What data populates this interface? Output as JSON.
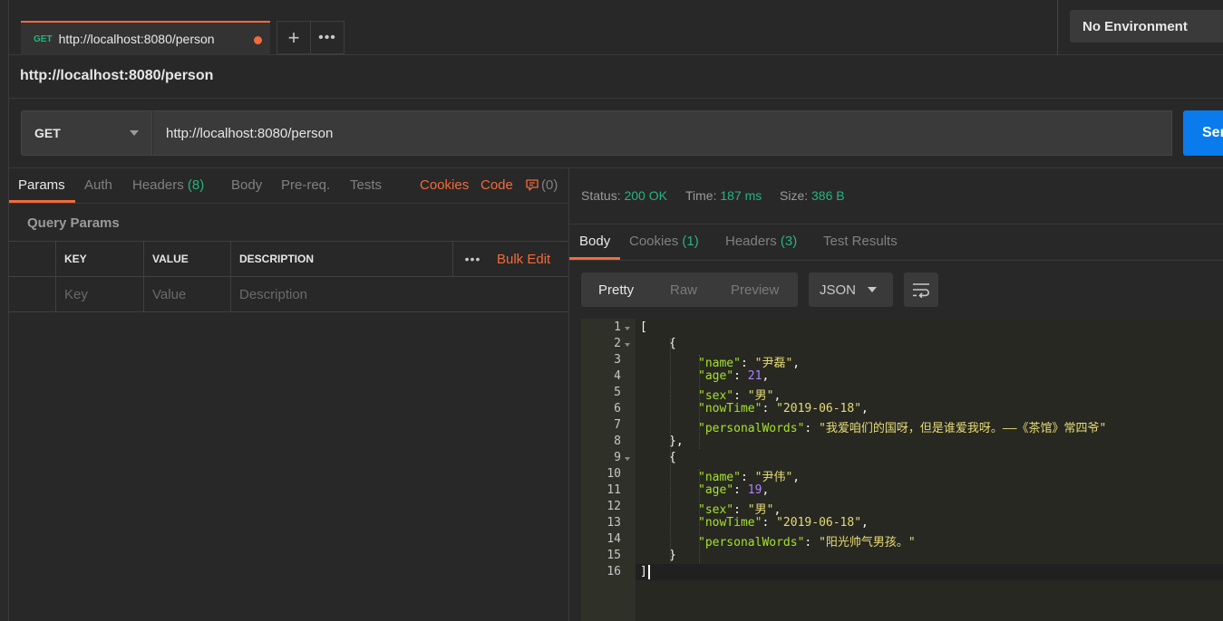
{
  "tab": {
    "method": "GET",
    "url": "http://localhost:8080/person"
  },
  "environment": {
    "selected": "No Environment"
  },
  "request": {
    "title": "http://localhost:8080/person",
    "method": "GET",
    "url": "http://localhost:8080/person",
    "send_label": "Send"
  },
  "request_tabs": {
    "params": "Params",
    "auth": "Auth",
    "headers": "Headers",
    "headers_count": "(8)",
    "body": "Body",
    "prereq": "Pre-req.",
    "tests": "Tests",
    "cookies": "Cookies",
    "code": "Code",
    "comments_count": "(0)"
  },
  "query_params": {
    "title": "Query Params",
    "headers": [
      "KEY",
      "VALUE",
      "DESCRIPTION"
    ],
    "bulk_edit": "Bulk Edit",
    "placeholders": [
      "Key",
      "Value",
      "Description"
    ]
  },
  "response": {
    "status_label": "Status:",
    "status_value": "200 OK",
    "time_label": "Time:",
    "time_value": "187 ms",
    "size_label": "Size:",
    "size_value": "386 B",
    "tabs": {
      "body": "Body",
      "cookies": "Cookies",
      "cookies_count": "(1)",
      "headers": "Headers",
      "headers_count": "(3)",
      "test_results": "Test Results"
    },
    "view_modes": [
      "Pretty",
      "Raw",
      "Preview"
    ],
    "format": "JSON"
  },
  "body_lines": [
    {
      "n": "1",
      "indent": 0,
      "parts": [
        [
          "p",
          "["
        ]
      ],
      "fold": true
    },
    {
      "n": "2",
      "indent": 1,
      "parts": [
        [
          "p",
          "{"
        ]
      ],
      "fold": true
    },
    {
      "n": "3",
      "indent": 2,
      "parts": [
        [
          "k",
          "\"name\""
        ],
        [
          "p",
          ": "
        ],
        [
          "s",
          "\"尹磊\""
        ],
        [
          "p",
          ","
        ]
      ]
    },
    {
      "n": "4",
      "indent": 2,
      "parts": [
        [
          "k",
          "\"age\""
        ],
        [
          "p",
          ": "
        ],
        [
          "n",
          "21"
        ],
        [
          "p",
          ","
        ]
      ]
    },
    {
      "n": "5",
      "indent": 2,
      "parts": [
        [
          "k",
          "\"sex\""
        ],
        [
          "p",
          ": "
        ],
        [
          "s",
          "\"男\""
        ],
        [
          "p",
          ","
        ]
      ]
    },
    {
      "n": "6",
      "indent": 2,
      "parts": [
        [
          "k",
          "\"nowTime\""
        ],
        [
          "p",
          ": "
        ],
        [
          "s",
          "\"2019-06-18\""
        ],
        [
          "p",
          ","
        ]
      ]
    },
    {
      "n": "7",
      "indent": 2,
      "parts": [
        [
          "k",
          "\"personalWords\""
        ],
        [
          "p",
          ": "
        ],
        [
          "s",
          "\"我爱咱们的国呀，但是谁爱我呀。——《茶馆》常四爷\""
        ]
      ]
    },
    {
      "n": "8",
      "indent": 1,
      "parts": [
        [
          "p",
          "},"
        ]
      ]
    },
    {
      "n": "9",
      "indent": 1,
      "parts": [
        [
          "p",
          "{"
        ]
      ],
      "fold": true
    },
    {
      "n": "10",
      "indent": 2,
      "parts": [
        [
          "k",
          "\"name\""
        ],
        [
          "p",
          ": "
        ],
        [
          "s",
          "\"尹伟\""
        ],
        [
          "p",
          ","
        ]
      ]
    },
    {
      "n": "11",
      "indent": 2,
      "parts": [
        [
          "k",
          "\"age\""
        ],
        [
          "p",
          ": "
        ],
        [
          "n",
          "19"
        ],
        [
          "p",
          ","
        ]
      ]
    },
    {
      "n": "12",
      "indent": 2,
      "parts": [
        [
          "k",
          "\"sex\""
        ],
        [
          "p",
          ": "
        ],
        [
          "s",
          "\"男\""
        ],
        [
          "p",
          ","
        ]
      ]
    },
    {
      "n": "13",
      "indent": 2,
      "parts": [
        [
          "k",
          "\"nowTime\""
        ],
        [
          "p",
          ": "
        ],
        [
          "s",
          "\"2019-06-18\""
        ],
        [
          "p",
          ","
        ]
      ]
    },
    {
      "n": "14",
      "indent": 2,
      "parts": [
        [
          "k",
          "\"personalWords\""
        ],
        [
          "p",
          ": "
        ],
        [
          "s",
          "\"阳光帅气男孩。\""
        ]
      ]
    },
    {
      "n": "15",
      "indent": 1,
      "parts": [
        [
          "p",
          "}"
        ]
      ]
    },
    {
      "n": "16",
      "indent": 0,
      "parts": [
        [
          "p",
          "]"
        ]
      ]
    }
  ],
  "colors": {
    "accent": "#f26b3a",
    "success": "#26b47f",
    "send": "#097bed"
  }
}
